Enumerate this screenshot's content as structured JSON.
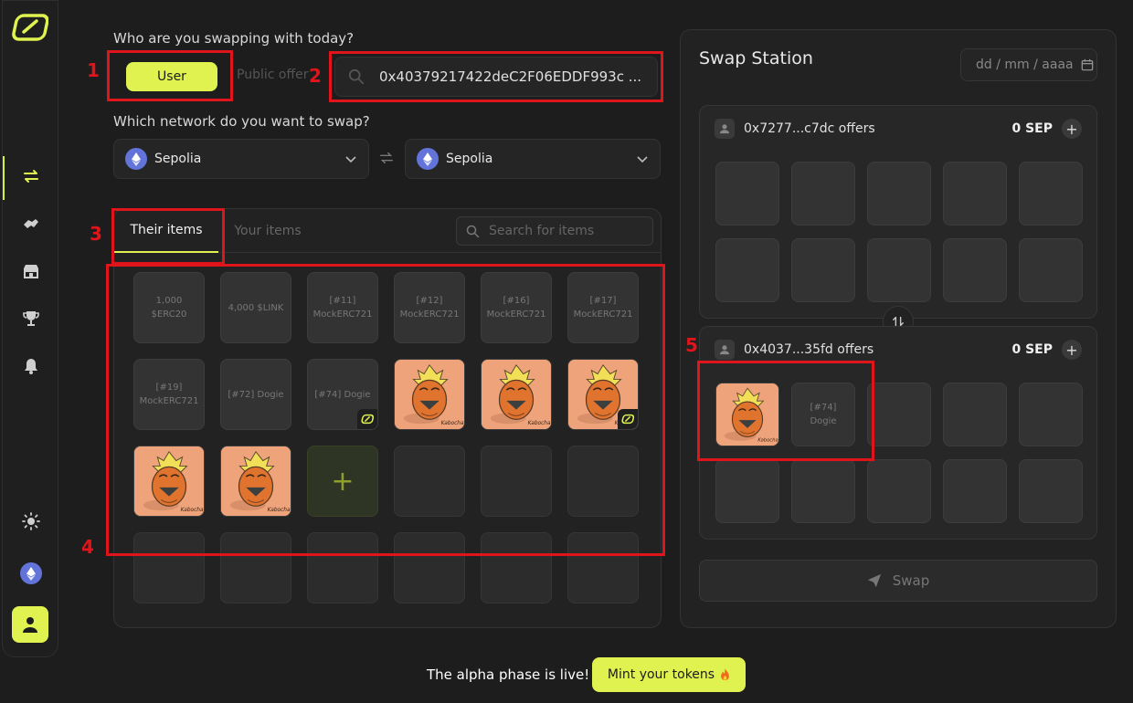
{
  "prompts": {
    "who": "Who are you swapping with today?",
    "network": "Which network do you want to swap?"
  },
  "mode": {
    "user": "User",
    "public_offer": "Public offer"
  },
  "address_input": {
    "value": "0x40379217422deC2F06EDDF993c ..."
  },
  "networks": {
    "from": "Sepolia",
    "to": "Sepolia"
  },
  "items_panel": {
    "tab_their": "Their items",
    "tab_your": "Your items",
    "search_placeholder": "Search for items",
    "cells": [
      {
        "type": "text",
        "label": "1,000 $ERC20"
      },
      {
        "type": "text",
        "label": "4,000 $LINK"
      },
      {
        "type": "text",
        "label": "[#11] MockERC721"
      },
      {
        "type": "text",
        "label": "[#12] MockERC721"
      },
      {
        "type": "text",
        "label": "[#16] MockERC721"
      },
      {
        "type": "text",
        "label": "[#17] MockERC721"
      },
      {
        "type": "text",
        "label": "[#19] MockERC721"
      },
      {
        "type": "text",
        "label": "[#72] Dogie"
      },
      {
        "type": "text",
        "label": "[#74] Dogie",
        "linked": true
      },
      {
        "type": "image",
        "label": "Kabocha"
      },
      {
        "type": "image",
        "label": "Kabocha"
      },
      {
        "type": "image",
        "label": "Kabocha",
        "linked": true
      },
      {
        "type": "image",
        "label": "Kabocha"
      },
      {
        "type": "image",
        "label": "Kabocha"
      },
      {
        "type": "add",
        "label": "+"
      },
      {
        "type": "empty"
      },
      {
        "type": "empty"
      },
      {
        "type": "empty"
      },
      {
        "type": "empty"
      },
      {
        "type": "empty"
      },
      {
        "type": "empty"
      },
      {
        "type": "empty"
      },
      {
        "type": "empty"
      },
      {
        "type": "empty"
      }
    ]
  },
  "station": {
    "title": "Swap Station",
    "date_placeholder": "dd / mm / aaaa",
    "offer_top": {
      "label": "0x7277...c7dc offers",
      "amount": "0 SEP"
    },
    "offer_bottom": {
      "label": "0x4037...35fd offers",
      "amount": "0 SEP",
      "item_label": "[#74] Dogie"
    },
    "swap_label": "Swap"
  },
  "banner": {
    "text": "The alpha phase is live!",
    "mint_label": "Mint your tokens"
  },
  "annotations": [
    "1",
    "2",
    "3",
    "4",
    "5"
  ],
  "colors": {
    "accent": "#dff250",
    "annotation": "#e0141b",
    "background": "#1d1d1d",
    "nft_bg": "#efa37a",
    "eth": "#6274d9"
  }
}
